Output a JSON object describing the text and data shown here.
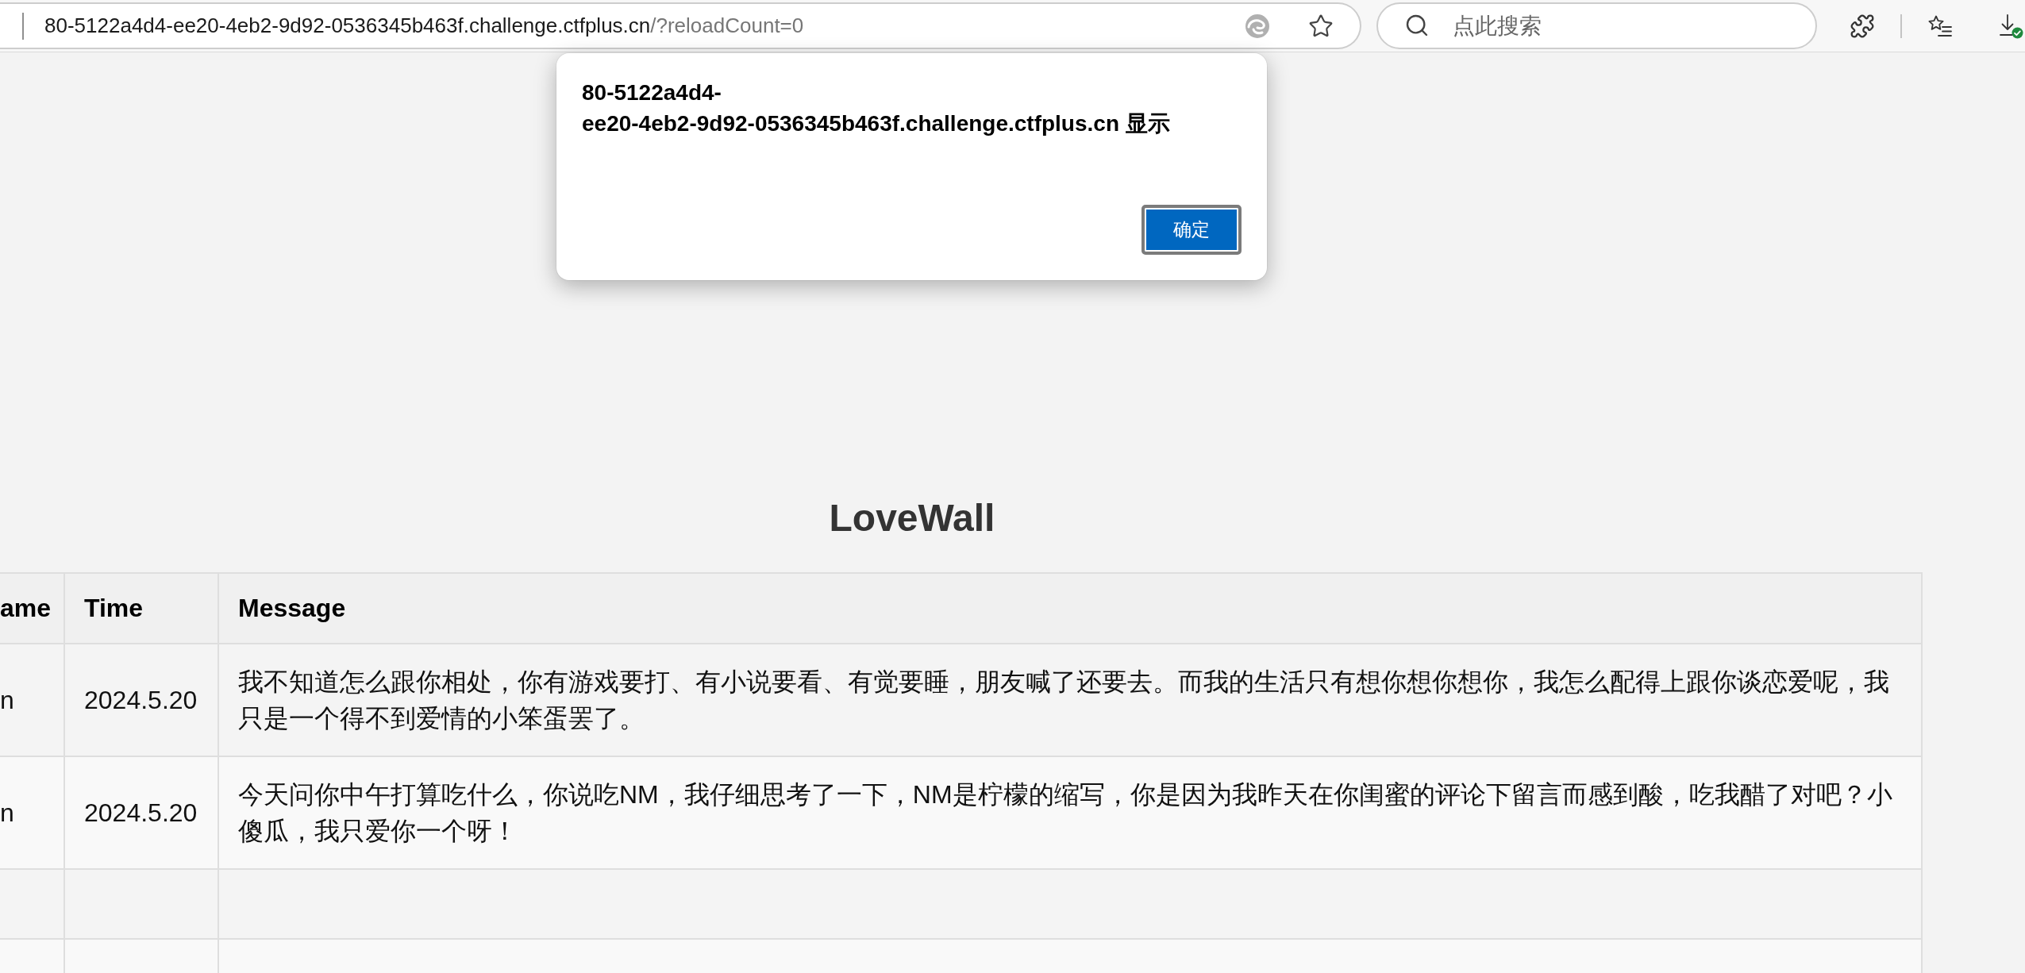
{
  "browser": {
    "address_bar": {
      "host": "80-5122a4d4-ee20-4eb2-9d92-0536345b463f.challenge.ctfplus.cn",
      "path": "/?reloadCount=0"
    },
    "search": {
      "placeholder": "点此搜索"
    }
  },
  "page": {
    "title": "LoveWall",
    "table": {
      "columns": [
        "ame",
        "Time",
        "Message"
      ],
      "rows": [
        {
          "column_1": "n",
          "time": "2024.5.20",
          "message": "我不知道怎么跟你相处，你有游戏要打、有小说要看、有觉要睡，朋友喊了还要去。而我的生活只有想你想你想你，我怎么配得上跟你谈恋爱呢，我只是一个得不到爱情的小笨蛋罢了。"
        },
        {
          "column_1": "n",
          "time": "2024.5.20",
          "message": "今天问你中午打算吃什么，你说吃NM，我仔细思考了一下，NM是柠檬的缩写，你是因为我昨天在你闺蜜的评论下留言而感到酸，吃我醋了对吧？小傻瓜，我只爱你一个呀！"
        },
        {},
        {}
      ]
    }
  },
  "dialog": {
    "message": "80-5122a4d4-ee20-4eb2-9d92-0536345b463f.challenge.ctfplus.cn 显示",
    "button": {
      "label": "确定",
      "focused": true
    }
  }
}
